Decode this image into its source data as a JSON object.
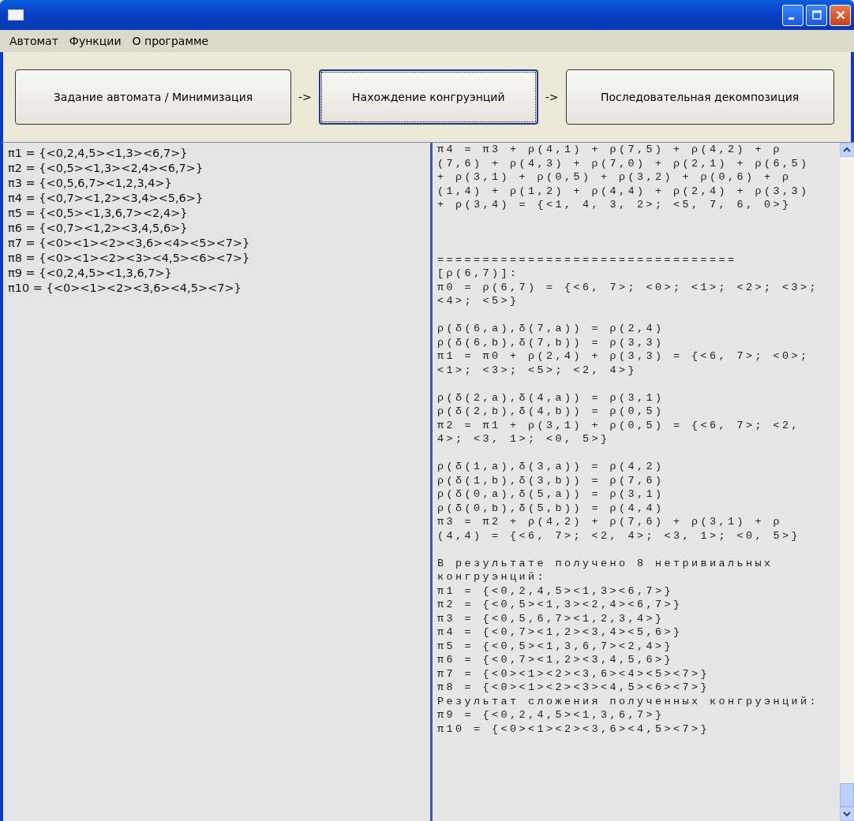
{
  "menu": [
    "Автомат",
    "Функции",
    "О программе"
  ],
  "steps": [
    {
      "label": "Задание автомата / Минимизация",
      "focused": false
    },
    {
      "label": "Нахождение конгруэнций",
      "focused": true
    },
    {
      "label": "Последовательная декомпозиция",
      "focused": false
    }
  ],
  "step_separators": [
    "->",
    "->"
  ],
  "congruences": [
    "π1 = {<0,2,4,5><1,3><6,7>}",
    "π2 = {<0,5><1,3><2,4><6,7>}",
    "π3 = {<0,5,6,7><1,2,3,4>}",
    "π4 = {<0,7><1,2><3,4><5,6>}",
    "π5 = {<0,5><1,3,6,7><2,4>}",
    "π6 = {<0,7><1,2><3,4,5,6>}",
    "π7 = {<0><1><2><3,6><4><5><7>}",
    "π8 = {<0><1><2><3><4,5><6><7>}",
    "π9 = {<0,2,4,5><1,3,6,7>}",
    "π10 = {<0><1><2><3,6><4,5><7>}"
  ],
  "log_blocks": [
    [
      "π4 = π3 + ρ(4,1) + ρ(7,5) + ρ(4,2) + ρ",
      "(7,6) + ρ(4,3) + ρ(7,0) + ρ(2,1) + ρ(6,5)",
      "+ ρ(3,1) + ρ(0,5) + ρ(3,2) + ρ(0,6) + ρ",
      "(1,4) + ρ(1,2) + ρ(4,4) + ρ(2,4) + ρ(3,3)",
      "+ ρ(3,4) = {<1, 4, 3, 2>; <5, 7, 6, 0>}"
    ],
    [
      "=================================",
      "[ρ(6,7)]:",
      "π0 = ρ(6,7) = {<6, 7>; <0>; <1>; <2>; <3>;",
      "<4>; <5>}"
    ],
    [
      "ρ(δ(6,a),δ(7,a)) = ρ(2,4)",
      "ρ(δ(6,b),δ(7,b)) = ρ(3,3)",
      "π1 = π0 + ρ(2,4) + ρ(3,3) = {<6, 7>; <0>;",
      "<1>; <3>; <5>; <2, 4>}"
    ],
    [
      "ρ(δ(2,a),δ(4,a)) = ρ(3,1)",
      "ρ(δ(2,b),δ(4,b)) = ρ(0,5)",
      "π2 = π1 + ρ(3,1) + ρ(0,5) = {<6, 7>; <2,",
      "4>; <3, 1>; <0, 5>}"
    ],
    [
      "ρ(δ(1,a),δ(3,a)) = ρ(4,2)",
      "ρ(δ(1,b),δ(3,b)) = ρ(7,6)",
      "ρ(δ(0,a),δ(5,a)) = ρ(3,1)",
      "ρ(δ(0,b),δ(5,b)) = ρ(4,4)",
      "π3 = π2 + ρ(4,2) + ρ(7,6) + ρ(3,1) + ρ",
      "(4,4) = {<6, 7>; <2, 4>; <3, 1>; <0, 5>}"
    ],
    [
      "В результате получено 8 нетривиальных",
      "конгруэнций:",
      "π1 = {<0,2,4,5><1,3><6,7>}",
      "π2 = {<0,5><1,3><2,4><6,7>}",
      "π3 = {<0,5,6,7><1,2,3,4>}",
      "π4 = {<0,7><1,2><3,4><5,6>}",
      "π5 = {<0,5><1,3,6,7><2,4>}",
      "π6 = {<0,7><1,2><3,4,5,6>}",
      "π7 = {<0><1><2><3,6><4><5><7>}",
      "π8 = {<0><1><2><3><4,5><6><7>}",
      "Результат сложения полученных конгруэнций:",
      "π9 = {<0,2,4,5><1,3,6,7>}",
      "π10 = {<0><1><2><3,6><4,5><7>}"
    ]
  ]
}
